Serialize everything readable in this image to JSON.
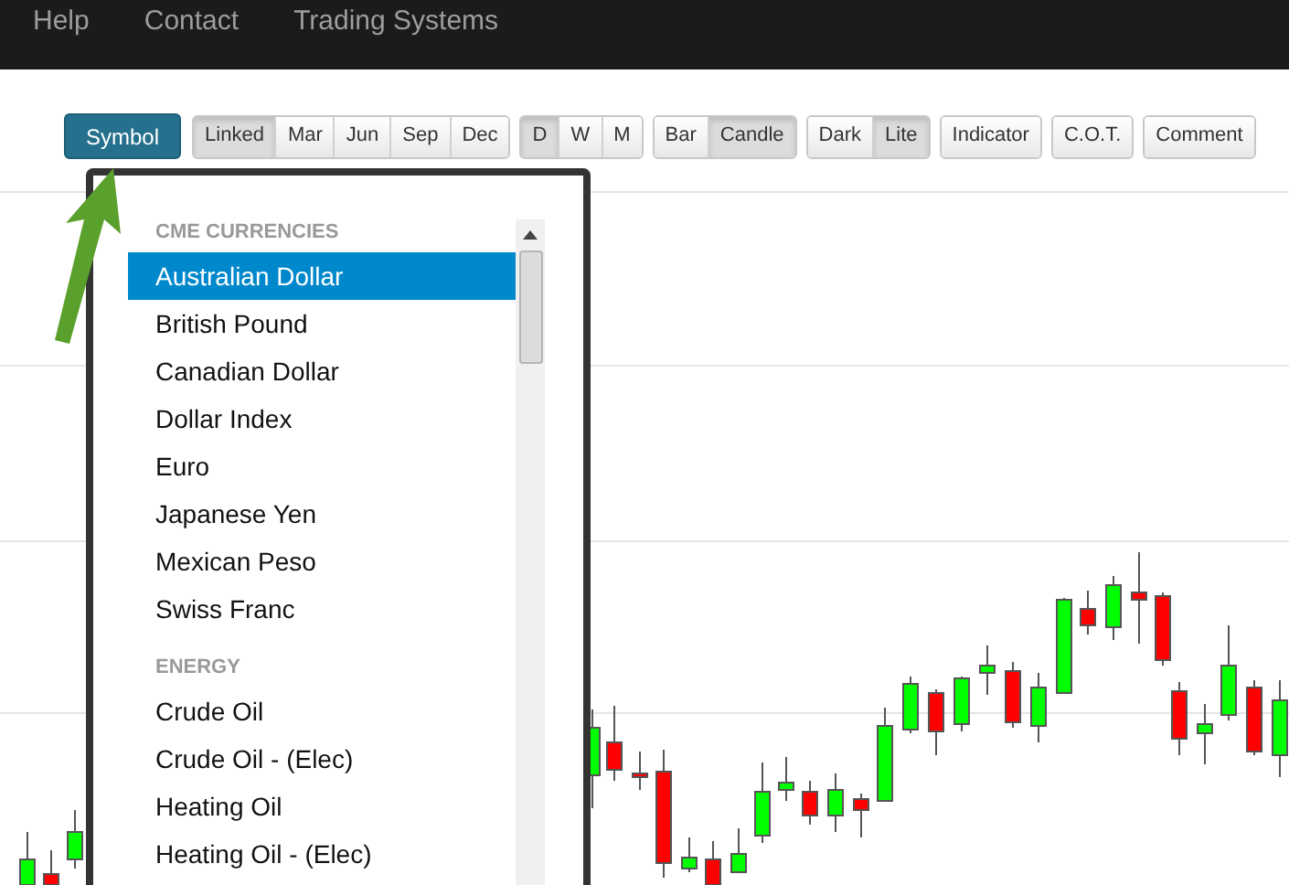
{
  "nav": [
    "Help",
    "Contact",
    "Trading Systems"
  ],
  "symbol_button": "Symbol",
  "toolbar_groups": [
    [
      {
        "label": "Linked",
        "selected": true
      },
      {
        "label": "Mar",
        "selected": false
      },
      {
        "label": "Jun",
        "selected": false
      },
      {
        "label": "Sep",
        "selected": false
      },
      {
        "label": "Dec",
        "selected": false
      }
    ],
    [
      {
        "label": "D",
        "selected": true
      },
      {
        "label": "W",
        "selected": false
      },
      {
        "label": "M",
        "selected": false
      }
    ],
    [
      {
        "label": "Bar",
        "selected": false
      },
      {
        "label": "Candle",
        "selected": true
      }
    ],
    [
      {
        "label": "Dark",
        "selected": false
      },
      {
        "label": "Lite",
        "selected": true
      }
    ],
    [
      {
        "label": "Indicator",
        "selected": false
      }
    ],
    [
      {
        "label": "C.O.T.",
        "selected": false
      }
    ],
    [
      {
        "label": "Comment",
        "selected": false
      }
    ]
  ],
  "dropdown": {
    "sections": [
      {
        "heading": "CME CURRENCIES",
        "items": [
          {
            "label": "Australian Dollar",
            "selected": true
          },
          {
            "label": "British Pound",
            "selected": false
          },
          {
            "label": "Canadian Dollar",
            "selected": false
          },
          {
            "label": "Dollar Index",
            "selected": false
          },
          {
            "label": "Euro",
            "selected": false
          },
          {
            "label": "Japanese Yen",
            "selected": false
          },
          {
            "label": "Mexican Peso",
            "selected": false
          },
          {
            "label": "Swiss Franc",
            "selected": false
          }
        ]
      },
      {
        "heading": "ENERGY",
        "items": [
          {
            "label": "Crude Oil",
            "selected": false
          },
          {
            "label": "Crude Oil - (Elec)",
            "selected": false
          },
          {
            "label": "Heating Oil",
            "selected": false
          },
          {
            "label": "Heating Oil - (Elec)",
            "selected": false
          }
        ]
      }
    ]
  }
}
